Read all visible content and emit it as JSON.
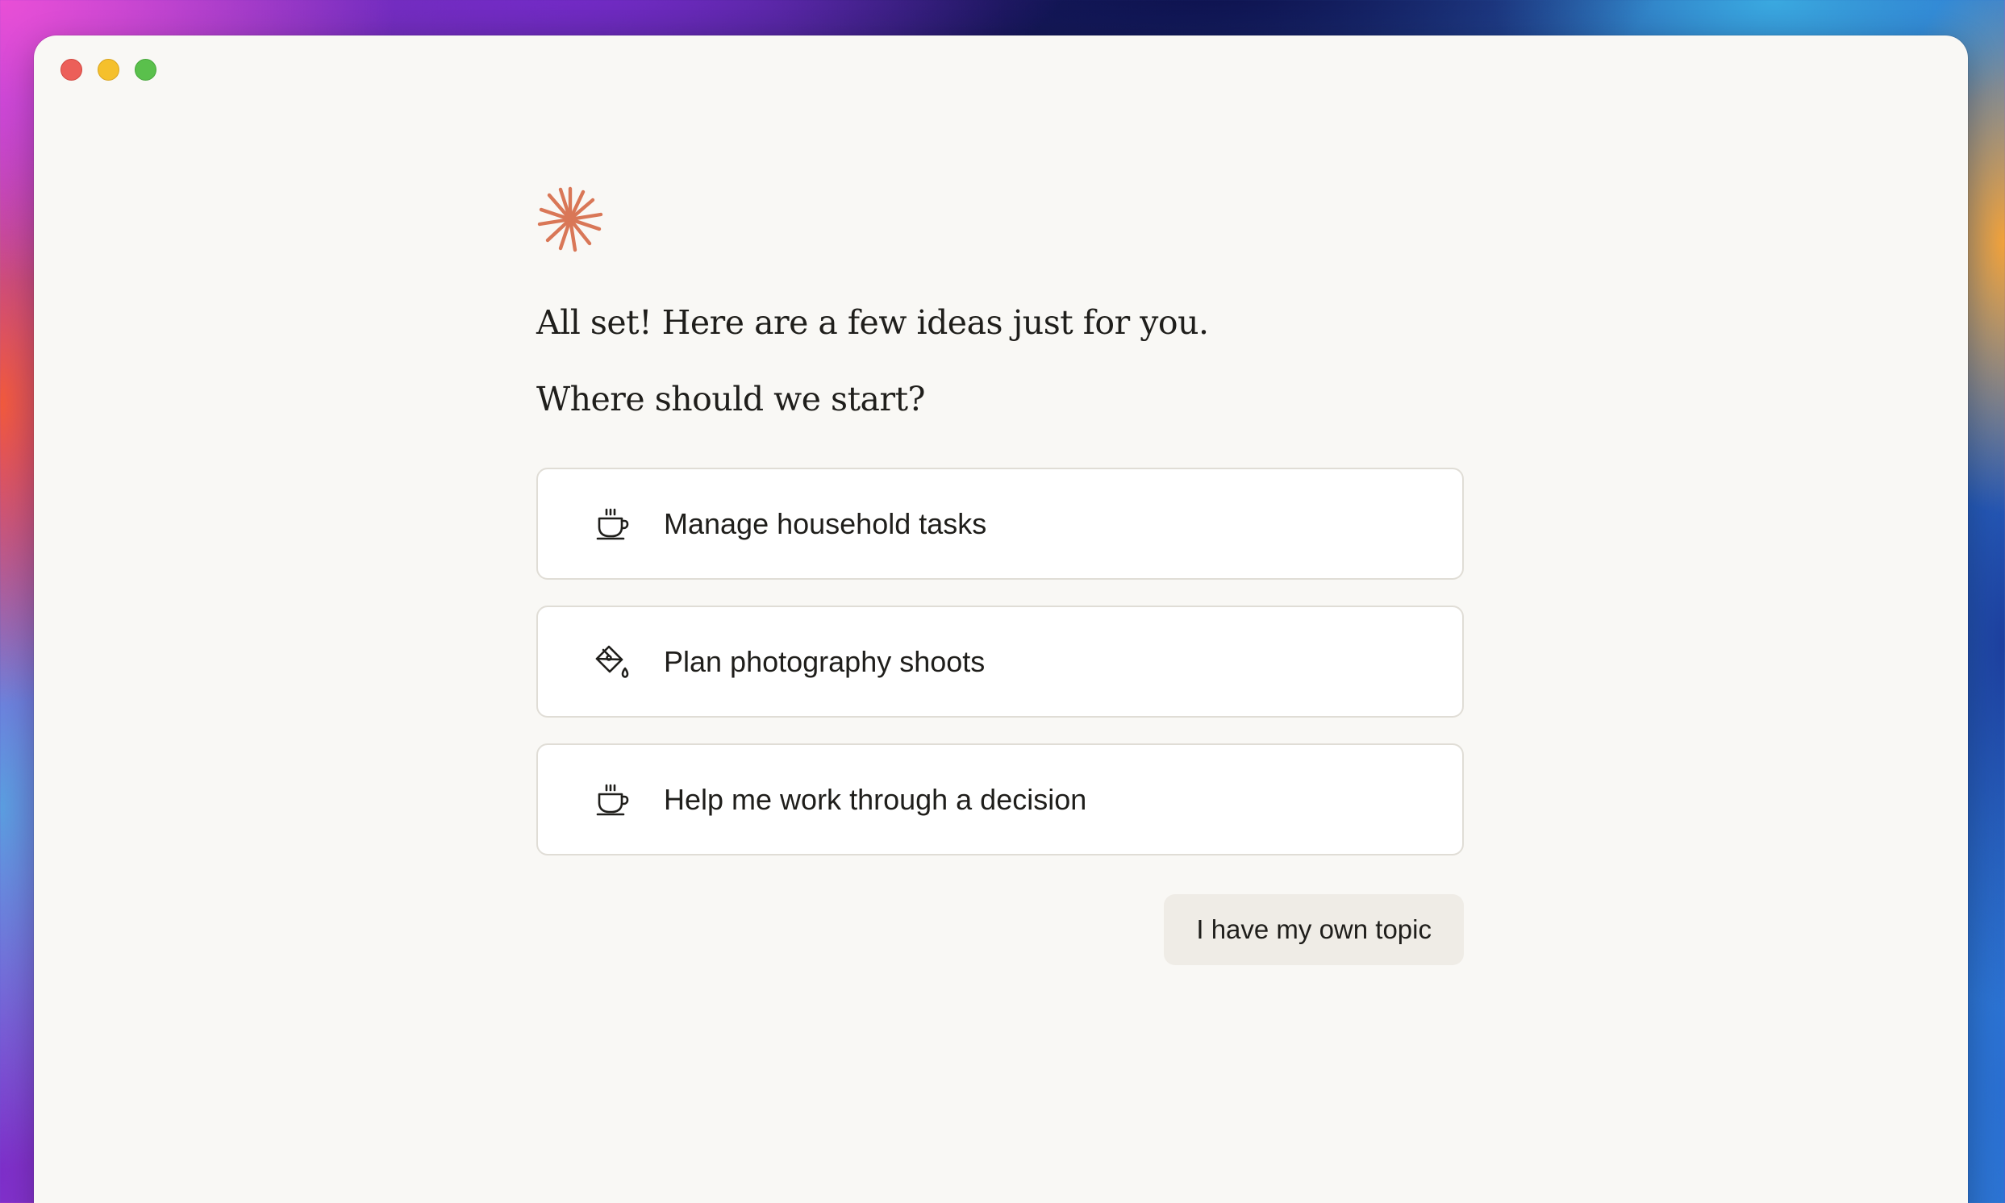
{
  "window": {
    "controls": [
      "close",
      "minimize",
      "maximize"
    ]
  },
  "brand": {
    "icon": "asterisk-logo-icon",
    "color": "#d97757"
  },
  "onboarding": {
    "headline": "All set! Here are a few ideas just for you.",
    "prompt": "Where should we start?",
    "options": [
      {
        "label": "Manage household tasks",
        "icon": "coffee-cup-icon"
      },
      {
        "label": "Plan photography shoots",
        "icon": "paint-bucket-icon"
      },
      {
        "label": "Help me work through a decision",
        "icon": "coffee-cup-icon"
      }
    ],
    "own_topic_label": "I have my own topic"
  }
}
